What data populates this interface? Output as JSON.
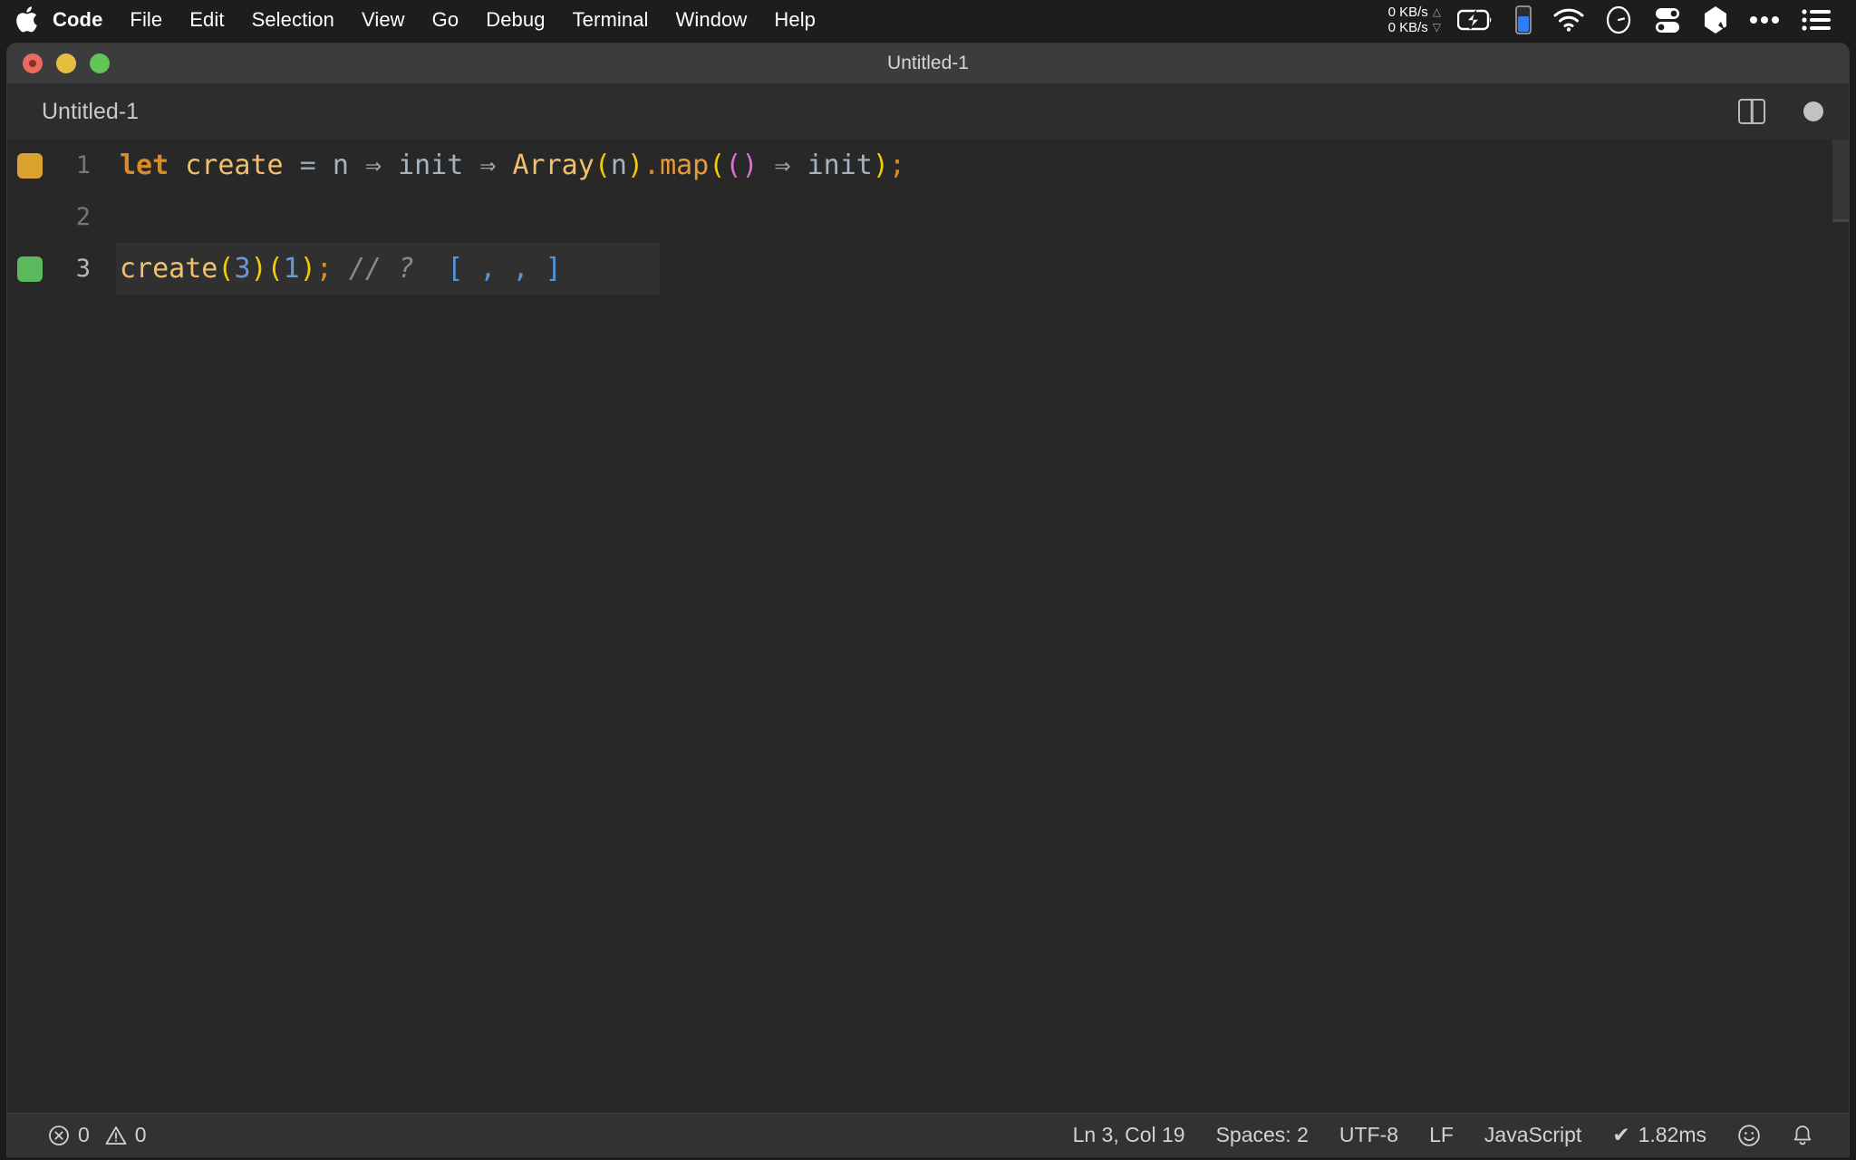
{
  "menubar": {
    "apple_icon": "apple-logo-icon",
    "items": [
      {
        "label": "Code",
        "bold": true
      },
      {
        "label": "File",
        "bold": false
      },
      {
        "label": "Edit",
        "bold": false
      },
      {
        "label": "Selection",
        "bold": false
      },
      {
        "label": "View",
        "bold": false
      },
      {
        "label": "Go",
        "bold": false
      },
      {
        "label": "Debug",
        "bold": false
      },
      {
        "label": "Terminal",
        "bold": false
      },
      {
        "label": "Window",
        "bold": false
      },
      {
        "label": "Help",
        "bold": false
      }
    ],
    "status": {
      "network_up": "0 KB/s",
      "network_down": "0 KB/s",
      "up_arrow": "△",
      "down_arrow": "▽",
      "icons": [
        "battery-charging-icon",
        "blue-level-meter-icon",
        "wifi-icon",
        "clock-gauge-icon",
        "toggles-icon",
        "gem-icon",
        "ellipsis-icon",
        "list-menu-icon"
      ]
    }
  },
  "window": {
    "title": "Untitled-1",
    "traffic_lights": [
      "close",
      "minimize",
      "maximize"
    ]
  },
  "tabbar": {
    "active_tab": "Untitled-1",
    "actions": [
      "split-editor-icon",
      "unsaved-indicator-dot"
    ]
  },
  "editor": {
    "language": "JavaScript",
    "lines": [
      {
        "number": "1",
        "marker_color": "#d9a22e",
        "current": false,
        "tokens": [
          {
            "text": "let",
            "cls": "t-kw"
          },
          {
            "text": " ",
            "cls": "t-op"
          },
          {
            "text": "create",
            "cls": "t-fn"
          },
          {
            "text": " = ",
            "cls": "t-op"
          },
          {
            "text": "n",
            "cls": "t-var"
          },
          {
            "text": " ",
            "cls": "t-op"
          },
          {
            "text": "⇒",
            "cls": "t-arrow"
          },
          {
            "text": " ",
            "cls": "t-op"
          },
          {
            "text": "init",
            "cls": "t-var"
          },
          {
            "text": " ",
            "cls": "t-op"
          },
          {
            "text": "⇒",
            "cls": "t-arrow"
          },
          {
            "text": " ",
            "cls": "t-op"
          },
          {
            "text": "Array",
            "cls": "t-fn"
          },
          {
            "text": "(",
            "cls": "t-paren1"
          },
          {
            "text": "n",
            "cls": "t-var"
          },
          {
            "text": ")",
            "cls": "t-paren1"
          },
          {
            "text": ".",
            "cls": "t-dot"
          },
          {
            "text": "map",
            "cls": "t-method"
          },
          {
            "text": "(",
            "cls": "t-paren1"
          },
          {
            "text": "()",
            "cls": "t-paren2"
          },
          {
            "text": " ",
            "cls": "t-op"
          },
          {
            "text": "⇒",
            "cls": "t-arrow"
          },
          {
            "text": " ",
            "cls": "t-op"
          },
          {
            "text": "init",
            "cls": "t-var"
          },
          {
            "text": ")",
            "cls": "t-paren1"
          },
          {
            "text": ";",
            "cls": "t-semi"
          }
        ]
      },
      {
        "number": "2",
        "marker_color": null,
        "current": false,
        "tokens": []
      },
      {
        "number": "3",
        "marker_color": "#5cb85c",
        "current": true,
        "tokens": [
          {
            "text": "create",
            "cls": "t-fn"
          },
          {
            "text": "(",
            "cls": "t-paren1"
          },
          {
            "text": "3",
            "cls": "t-num"
          },
          {
            "text": ")",
            "cls": "t-paren1"
          },
          {
            "text": "(",
            "cls": "t-paren1"
          },
          {
            "text": "1",
            "cls": "t-num"
          },
          {
            "text": ")",
            "cls": "t-paren1"
          },
          {
            "text": ";",
            "cls": "t-semi"
          },
          {
            "text": " ",
            "cls": "t-op"
          },
          {
            "text": "// ?",
            "cls": "t-comment"
          },
          {
            "text": "  ",
            "cls": "t-op"
          },
          {
            "text": "[ , , ]",
            "cls": "t-result"
          }
        ]
      }
    ]
  },
  "statusbar": {
    "errors_icon": "error-circle-icon",
    "errors": "0",
    "warnings_icon": "warning-triangle-icon",
    "warnings": "0",
    "cursor_position": "Ln 3, Col 19",
    "indentation": "Spaces: 2",
    "encoding": "UTF-8",
    "eol": "LF",
    "language_mode": "JavaScript",
    "run_status_check": "✔",
    "run_time": "1.82ms",
    "feedback_icon": "smiley-icon",
    "notifications_icon": "bell-icon"
  },
  "colors": {
    "menubar_bg": "#1d1d1d",
    "titlebar_bg": "#3c3c3c",
    "tabbar_bg": "#2d2d2d",
    "editor_bg": "#282828",
    "current_line_bg": "#303030",
    "statusbar_bg": "#323232",
    "marker_pending": "#d9a22e",
    "marker_ok": "#5cb85c",
    "result_blue": "#4f97dc"
  }
}
